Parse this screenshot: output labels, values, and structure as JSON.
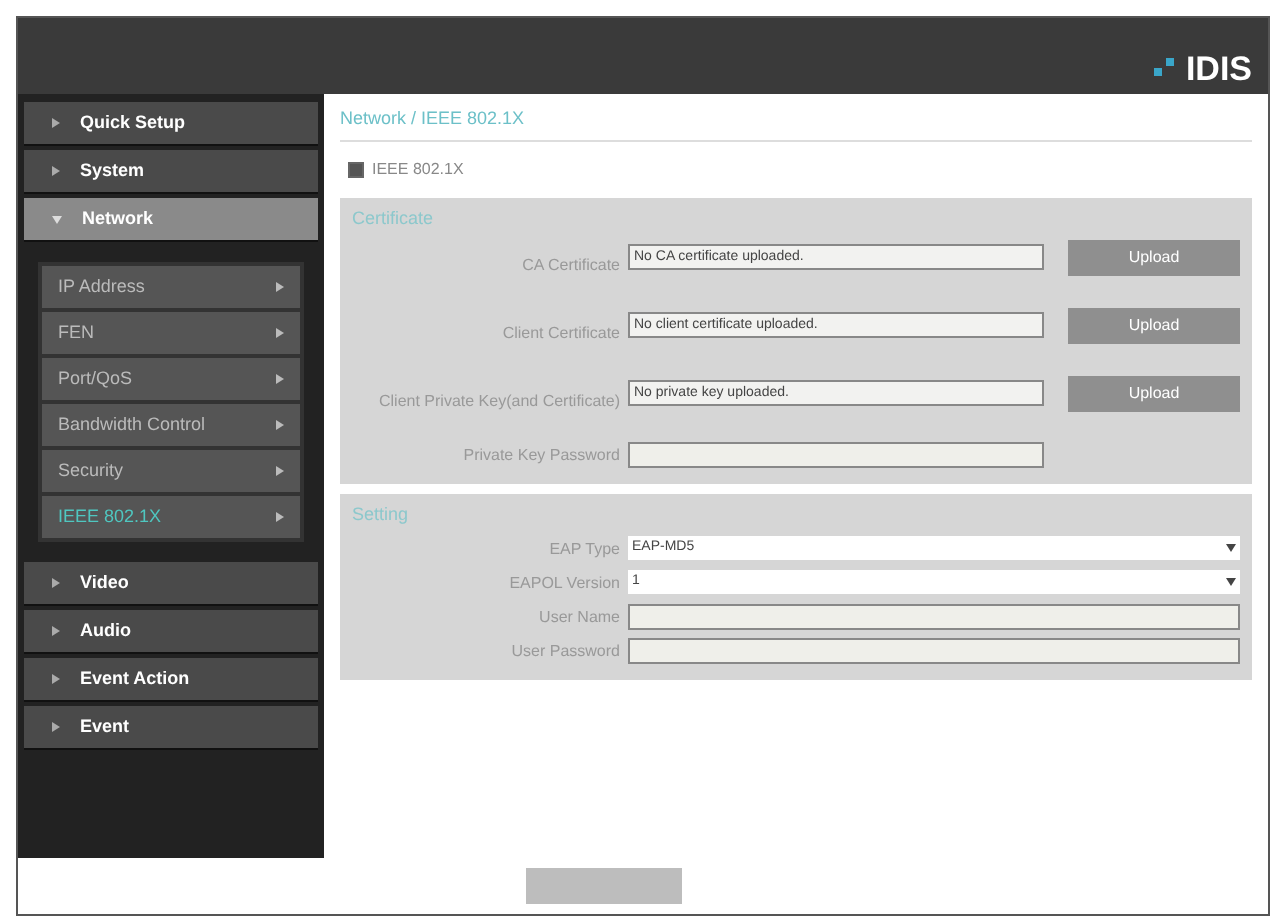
{
  "header": {
    "logo": "IDIS"
  },
  "sidebar": {
    "items": [
      {
        "label": "Quick Setup",
        "selected": false,
        "expanded": false
      },
      {
        "label": "System",
        "selected": false,
        "expanded": false
      },
      {
        "label": "Network",
        "selected": true,
        "expanded": true,
        "children": [
          {
            "label": "IP Address",
            "selected": false
          },
          {
            "label": "FEN",
            "selected": false
          },
          {
            "label": "Port/QoS",
            "selected": false
          },
          {
            "label": "Bandwidth Control",
            "selected": false
          },
          {
            "label": "Security",
            "selected": false
          },
          {
            "label": "IEEE 802.1X",
            "selected": true
          }
        ]
      },
      {
        "label": "Video",
        "selected": false,
        "expanded": false
      },
      {
        "label": "Audio",
        "selected": false,
        "expanded": false
      },
      {
        "label": "Event Action",
        "selected": false,
        "expanded": false
      },
      {
        "label": "Event",
        "selected": false,
        "expanded": false
      }
    ]
  },
  "breadcrumb": "Network / IEEE 802.1X",
  "enable": {
    "label": "IEEE 802.1X",
    "checked": true
  },
  "sections": [
    {
      "title": "Certificate",
      "rows": [
        {
          "kind": "file",
          "label": "CA Certificate",
          "value": "No CA certificate uploaded.",
          "button": "Upload"
        },
        {
          "kind": "file",
          "label": "Client Certificate",
          "value": "No client certificate uploaded.",
          "button": "Upload"
        },
        {
          "kind": "file",
          "label": "Client Private Key(and Certificate)",
          "value": "No private key uploaded.",
          "button": "Upload"
        },
        {
          "kind": "text",
          "label": "Private Key Password"
        }
      ]
    },
    {
      "title": "Setting",
      "rows": [
        {
          "kind": "select",
          "label": "EAP Type",
          "value": "EAP-MD5"
        },
        {
          "kind": "select",
          "label": "EAPOL Version",
          "value": "1"
        },
        {
          "kind": "text",
          "label": "User Name"
        },
        {
          "kind": "text",
          "label": "User Password"
        }
      ]
    }
  ]
}
